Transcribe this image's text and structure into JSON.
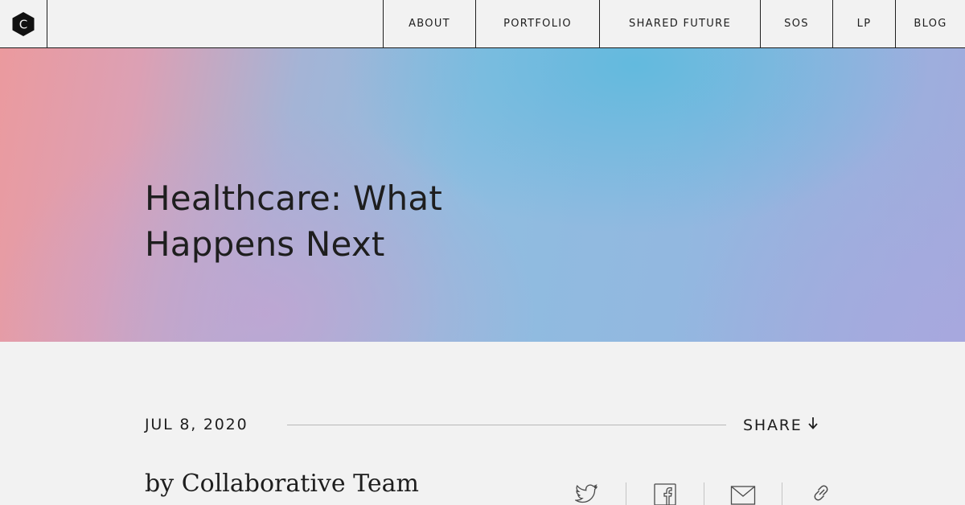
{
  "header": {
    "logo_letter": "C",
    "nav": [
      {
        "label": "ABOUT"
      },
      {
        "label": "PORTFOLIO"
      },
      {
        "label": "SHARED FUTURE"
      },
      {
        "label": "SOS"
      },
      {
        "label": "LP"
      },
      {
        "label": "BLOG"
      }
    ]
  },
  "hero": {
    "title": "Healthcare: What Happens Next"
  },
  "article": {
    "date": "JUL 8, 2020",
    "share_label": "SHARE",
    "byline": "by Collaborative Team"
  },
  "share_icons": [
    "twitter-icon",
    "facebook-icon",
    "email-icon",
    "link-icon"
  ]
}
